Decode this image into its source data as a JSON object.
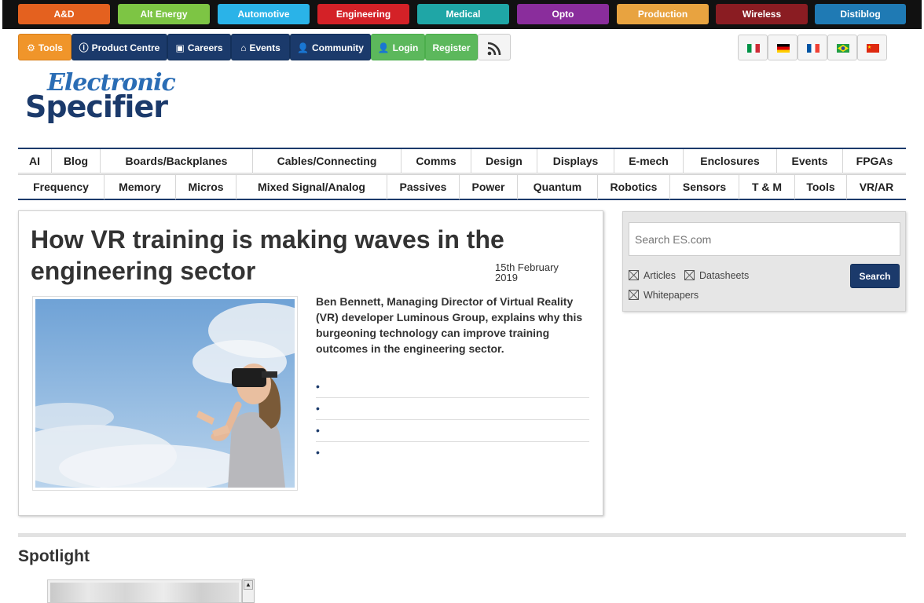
{
  "sections": [
    {
      "label": "A&D",
      "color": "#e4611f"
    },
    {
      "label": "Alt Energy",
      "color": "#7dc544"
    },
    {
      "label": "Automotive",
      "color": "#2ab3e8"
    },
    {
      "label": "Engineering",
      "color": "#d42127"
    },
    {
      "label": "Medical",
      "color": "#1fa6a6"
    },
    {
      "label": "Opto",
      "color": "#8a2d9c"
    },
    {
      "label": "Production",
      "color": "#e8a340"
    },
    {
      "label": "Wireless",
      "color": "#8a1c22"
    },
    {
      "label": "Distiblog",
      "color": "#1f7ab4"
    }
  ],
  "toolbar": {
    "tools": "Tools",
    "product_centre": "Product Centre",
    "careers": "Careers",
    "events": "Events",
    "community": "Community",
    "login": "Login",
    "register": "Register"
  },
  "logo": {
    "script": "Electronic",
    "main": "Specifier"
  },
  "categories_row1": [
    "AI",
    "Blog",
    "Boards/Backplanes",
    "Cables/Connecting",
    "Comms",
    "Design",
    "Displays",
    "E-mech",
    "Enclosures",
    "Events",
    "FPGAs"
  ],
  "categories_row2": [
    "Frequency",
    "Memory",
    "Micros",
    "Mixed Signal/Analog",
    "Passives",
    "Power",
    "Quantum",
    "Robotics",
    "Sensors",
    "T & M",
    "Tools",
    "VR/AR"
  ],
  "article": {
    "title": "How VR training is making waves in the engineering sector",
    "date": "15th February 2019",
    "lede": "Ben Bennett, Managing Director of Virtual Reality (VR) developer Luminous Group, explains why this burgeoning technology can improve training outcomes in the engineering sector.",
    "bullets": [
      "•",
      "•",
      "•",
      "•"
    ]
  },
  "search": {
    "placeholder": "Search ES.com",
    "options": [
      "Articles",
      "Datasheets",
      "Whitepapers"
    ],
    "button": "Search"
  },
  "spotlight": {
    "title": "Spotlight"
  }
}
